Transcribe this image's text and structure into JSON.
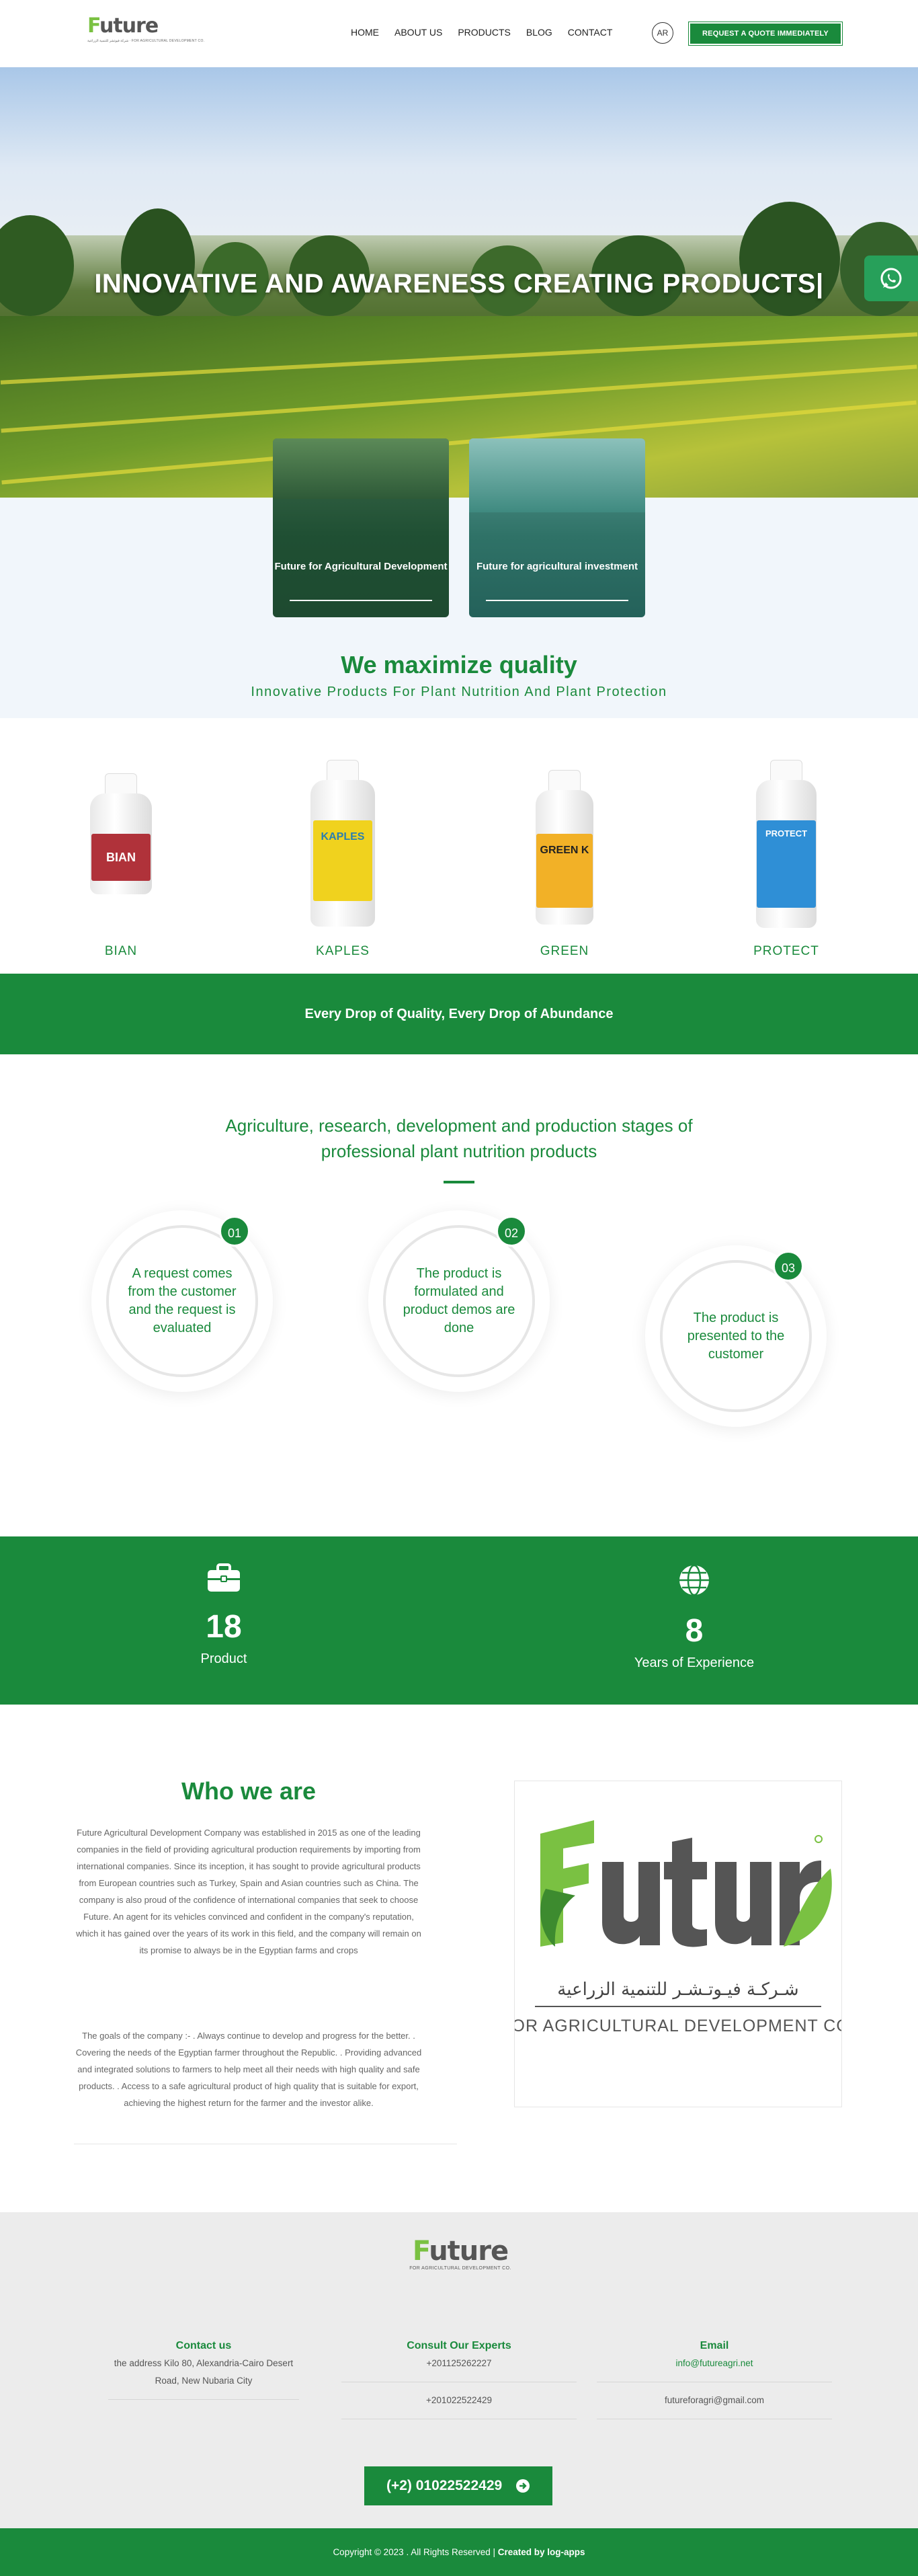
{
  "header": {
    "logo_letter": "F",
    "logo_rest": "uture",
    "logo_sub": "شركة فيوتشر للتنمية الزراعية · FOR AGRICULTURAL DEVELOPMENT CO.",
    "nav": [
      "HOME",
      "ABOUT US",
      "PRODUCTS",
      "BLOG",
      "CONTACT"
    ],
    "lang": "AR",
    "quote_button": "REQUEST A QUOTE IMMEDIATELY"
  },
  "hero": {
    "title": "INNOVATIVE AND AWARENESS CREATING PRODUCTS|",
    "whatsapp_icon": "whatsapp-icon"
  },
  "cards": [
    {
      "title": "Future for Agricultural Development"
    },
    {
      "title": "Future for agricultural investment"
    }
  ],
  "quality": {
    "title": "We maximize quality",
    "subtitle": "Innovative Products For Plant Nutrition And Plant Protection"
  },
  "products": [
    {
      "name": "BIAN",
      "label": "BIAN",
      "label_color": "#b0323a"
    },
    {
      "name": "KAPLES",
      "label": "KAPLES",
      "label_color": "#f0d21e"
    },
    {
      "name": "GREEN",
      "label": "GREEN K",
      "label_color": "#f2b127"
    },
    {
      "name": "PROTECT",
      "label": "PROTECT",
      "label_color": "#2f8fd6"
    }
  ],
  "slogan": "Every Drop of Quality, Every Drop of Abundance",
  "steps": {
    "title_line1": "Agriculture, research, development and production stages of",
    "title_line2": "professional plant nutrition products",
    "items": [
      {
        "num": "01",
        "text": "A request comes from the customer and the request is evaluated"
      },
      {
        "num": "02",
        "text": "The product is formulated and product demos are done"
      },
      {
        "num": "03",
        "text": "The product is presented to the customer"
      }
    ]
  },
  "stats": [
    {
      "icon": "briefcase-icon",
      "value": "18",
      "label": "Product"
    },
    {
      "icon": "globe-icon",
      "value": "8",
      "label": "Years of Experience"
    }
  ],
  "about": {
    "title": "Who we are",
    "p1": "Future Agricultural Development Company was established in 2015 as one of the leading companies in the field of providing agricultural production requirements by importing from international companies. Since its inception, it has sought to provide agricultural products from European countries such as Turkey, Spain and Asian countries such as China. The company is also proud of the confidence of international companies that seek to choose Future. An agent for its vehicles convinced and confident in the company's reputation, which it has gained over the years of its work in this field, and the company will remain on its promise to always be in the Egyptian farms and crops",
    "p2": "The goals of the company :- . Always continue to develop and progress for the better. . Covering the needs of the Egyptian farmer throughout the Republic. . Providing advanced and integrated solutions to farmers to help meet all their needs with high quality and safe products. . Access to a safe agricultural product of high quality that is suitable for export, achieving the highest return for the farmer and the investor alike.",
    "image_arabic": "شـركـة فيـوتـشـر للتنمية الزراعية",
    "image_english": "FOR AGRICULTURAL DEVELOPMENT CO."
  },
  "footer": {
    "logo_sub": "FOR AGRICULTURAL DEVELOPMENT CO.",
    "contact_head": "Contact us",
    "contact_addr": "the address Kilo 80, Alexandria-Cairo Desert Road, New Nubaria City",
    "experts_head": "Consult Our Experts",
    "phone1": "+201125262227",
    "phone2": "+201022522429",
    "email_head": "Email",
    "email1": "info@futureagri.net",
    "email2": "futureforagri@gmail.com",
    "call_button": "(+2) 01022522429",
    "copyright": "Copyright © 2023 . All Rights Reserved  |",
    "created_by": "Created by log-apps"
  },
  "colors": {
    "brand_green": "#1a8a3c",
    "logo_light_green": "#7ac142"
  }
}
